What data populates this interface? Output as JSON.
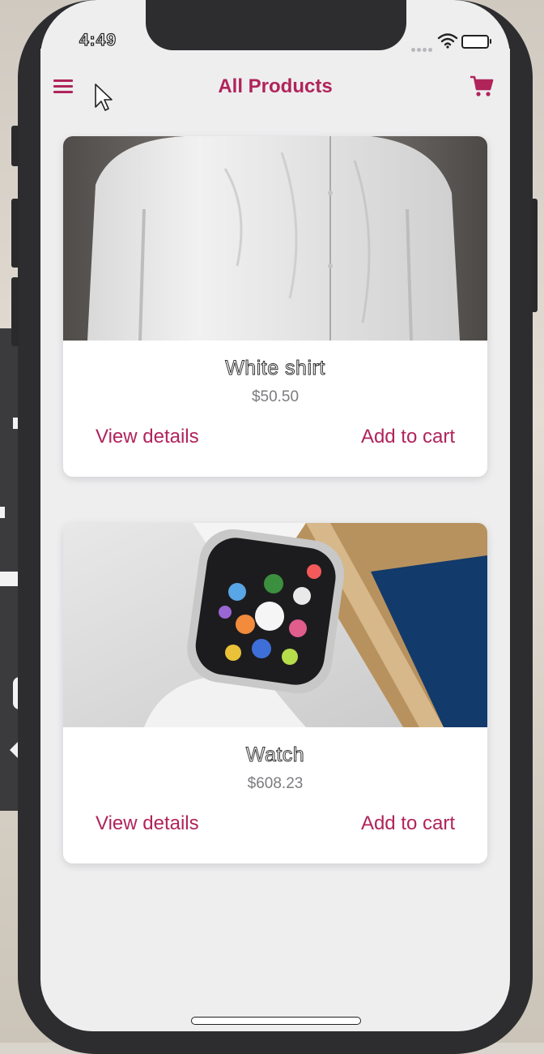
{
  "status_bar": {
    "time": "4:49",
    "signal_icon": "signal-dots-icon",
    "wifi_icon": "wifi-icon",
    "battery_icon": "battery-icon"
  },
  "header": {
    "title": "All Products",
    "menu_icon": "hamburger-menu-icon",
    "cart_icon": "shopping-cart-icon",
    "accent_color": "#b0245a"
  },
  "products": [
    {
      "name": "White shirt",
      "price": "$50.50",
      "image_icon": "white-shirt-photo",
      "details_label": "View details",
      "add_label": "Add to cart"
    },
    {
      "name": "Watch",
      "price": "$608.23",
      "image_icon": "smartwatch-photo",
      "details_label": "View details",
      "add_label": "Add to cart"
    }
  ]
}
